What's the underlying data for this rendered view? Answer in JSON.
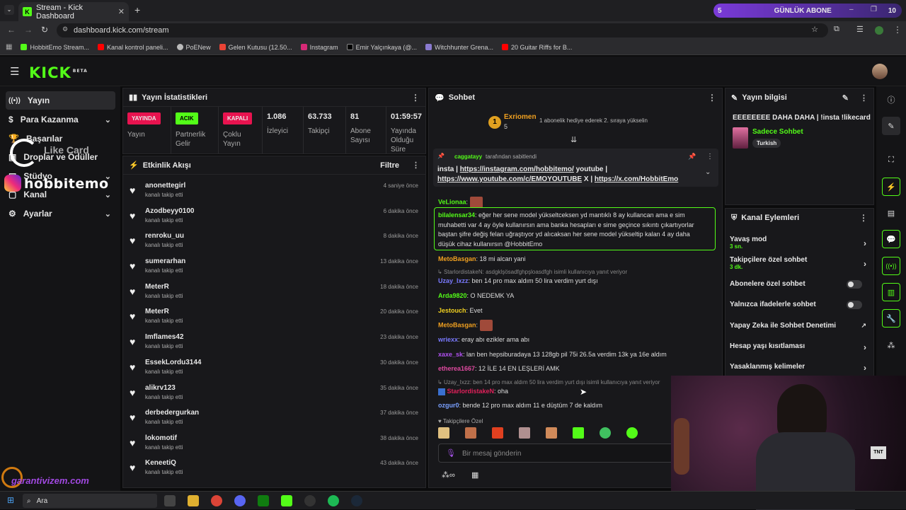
{
  "browser": {
    "tab_title": "Stream - Kick Dashboard",
    "url": "dashboard.kick.com/stream",
    "bookmarks": [
      "HobbitEmo Stream...",
      "Kanal kontrol paneli...",
      "PoENew",
      "Gelen Kutusu (12.50...",
      "Instagram",
      "Emir Yalçınkaya (@...",
      "Witchhunter Grena...",
      "20 Guitar Riffs for B..."
    ],
    "promo_count": "5",
    "promo_label": "GÜNLÜK ABONE",
    "promo_value": "10"
  },
  "header": {
    "logo": "KICK",
    "logo_badge": "BETA"
  },
  "sidebar": {
    "items": [
      {
        "label": "Yayın"
      },
      {
        "label": "Para Kazanma"
      },
      {
        "label": "Başarılar"
      },
      {
        "label": "Droplar ve Ödüller"
      },
      {
        "label": "Stüdyo"
      },
      {
        "label": "Kanal"
      },
      {
        "label": "Ayarlar"
      }
    ],
    "overlay_brand": "hobbitemo",
    "overlay_likecard": "Like Card"
  },
  "stats": {
    "title": "Yayın İstatistikleri",
    "cells": [
      {
        "badge": "YAYINDA",
        "label": "Yayın"
      },
      {
        "badge": "ACIK",
        "label": "Partnerlik Gelir"
      },
      {
        "badge": "KAPALI",
        "label": "Çoklu Yayın"
      },
      {
        "value": "1.086",
        "label": "İzleyici"
      },
      {
        "value": "63.733",
        "label": "Takipçi"
      },
      {
        "value": "81",
        "label": "Abone Sayısı"
      },
      {
        "value": "01:59:57",
        "label": "Yayında Olduğu Süre"
      }
    ],
    "colors": {
      "live": "#e8134f",
      "open": "#53fc18",
      "closed": "#e8134f"
    }
  },
  "activity": {
    "title": "Etkinlik Akışı",
    "filter": "Filtre",
    "events": [
      {
        "name": "anonettegirl",
        "sub": "kanalı takip etti",
        "time": "4 saniye önce"
      },
      {
        "name": "Azodbeyy0100",
        "sub": "kanalı takip etti",
        "time": "6 dakika önce"
      },
      {
        "name": "renroku_uu",
        "sub": "kanalı takip etti",
        "time": "8 dakika önce"
      },
      {
        "name": "sumerarhan",
        "sub": "kanalı takip etti",
        "time": "13 dakika önce"
      },
      {
        "name": "MeterR",
        "sub": "kanalı takip etti",
        "time": "18 dakika önce"
      },
      {
        "name": "MeterR",
        "sub": "kanalı takip etti",
        "time": "20 dakika önce"
      },
      {
        "name": "Imflames42",
        "sub": "kanalı takip etti",
        "time": "23 dakika önce"
      },
      {
        "name": "EssekLordu3144",
        "sub": "kanalı takip etti",
        "time": "30 dakika önce"
      },
      {
        "name": "alikrv123",
        "sub": "kanalı takip etti",
        "time": "35 dakika önce"
      },
      {
        "name": "derbedergurkan",
        "sub": "kanalı takip etti",
        "time": "37 dakika önce"
      },
      {
        "name": "lokomotif",
        "sub": "kanalı takip etti",
        "time": "38 dakika önce"
      },
      {
        "name": "KeneetiQ",
        "sub": "kanalı takip etti",
        "time": "43 dakika önce"
      }
    ]
  },
  "chat": {
    "title": "Sohbet",
    "gift_user": "Exriomen",
    "gift_count": "5",
    "gift_rank": "1",
    "gift_text": "1 abonelik hediye ederek 2. sıraya yükselin",
    "pinned_by_user": "caggatayy",
    "pinned_by_text": "tarafından sabitlendi",
    "pinned_line1_a": "insta | ",
    "pinned_link1": "https://instagram.com/hobbitemo/",
    "pinned_line1_b": " youtube |",
    "pinned_link2": "https://www.youtube.com/c/EMOYOUTUBE",
    "pinned_line2_b": " X | ",
    "pinned_link3": "https://x.com/HobbitEmo",
    "messages": [
      {
        "user": "VeLionaa",
        "text": ""
      },
      {
        "user": "bilalensar34",
        "text": ": eğer her sene model yükseltceksen yd mantıklı 8 ay kullancan ama e sim"
      },
      {
        "user": "",
        "text": "muhabetti var 4 ay öyle kullanırsın ama banka hesapları e sime geçince sıkıntı çıkartıyorlar"
      },
      {
        "user": "",
        "text": "baştan şifre değiş felan uğraştıyor yd alıcaksan her sene model yükseltip kalan 4 ay daha"
      },
      {
        "user": "",
        "text": "düşük cihaz kullanırsın @HobbitEmo"
      },
      {
        "user": "MetoBasgan",
        "text": ": 18 mi alcan yani"
      },
      {
        "user": "StarlordistakeN",
        "text": ": asdgklşösadfghpşloasdfgh isimli kullanıcıya yanıt veriyor"
      },
      {
        "user": "Uzay_Ixzz",
        "text": ": ben 14 pro max aldım 50 lira verdim yurt dışı"
      },
      {
        "user": "Arda9820",
        "text": ": O NEDEMK YA"
      },
      {
        "user": "Jestouch",
        "text": ": Evet"
      },
      {
        "user": "MetoBasgan",
        "text": ""
      },
      {
        "user": "wriexx",
        "text": ": eray abı ezikler ama abı"
      },
      {
        "user": "xaxe_sk",
        "text": ": lan ben hepsiburadaya 13 128gb pil 75i 26.5a verdim 13k ya 16e aldım"
      },
      {
        "user": "etherea1667",
        "text": ": 12 İLE 14 EN LEŞLERİ AMK"
      },
      {
        "user": "Uzay_Ixzz",
        "text": ": ben 14 pro max aldım 50 lira verdim yurt dışı isimli kullanıcıya yanıt veriyor"
      },
      {
        "user": "StarlordistakeN",
        "text": ": oha"
      },
      {
        "user": "ozgur0",
        "text": ": bende 12 pro max aldım 11 e düştüm 7 de kaldım"
      }
    ],
    "followers_label": "Takipçilere Özel",
    "input_placeholder": "Bir mesaj gönderin"
  },
  "stream_info": {
    "title": "Yayın bilgisi",
    "stream_title": "EEEEEEEE DAHA DAHA | !insta !likecard",
    "category": "Sadece Sohbet",
    "tag": "Turkish"
  },
  "channel_actions": {
    "title": "Kanal Eylemleri",
    "items": [
      {
        "label": "Yavaş mod",
        "sub": "3 sn.",
        "control": "arrow"
      },
      {
        "label": "Takipçilere özel sohbet",
        "sub": "3 dk.",
        "control": "arrow"
      },
      {
        "label": "Abonelere özel sohbet",
        "sub": "",
        "control": "toggle"
      },
      {
        "label": "Yalnızca ifadelerle sohbet",
        "sub": "",
        "control": "toggle"
      },
      {
        "label": "Yapay Zeka ile Sohbet Denetimi",
        "sub": "",
        "control": "external"
      },
      {
        "label": "Hesap yaşı kısıtlaması",
        "sub": "",
        "control": "arrow"
      },
      {
        "label": "Yasaklanmış kelimeler",
        "sub": "",
        "control": "arrow"
      }
    ]
  },
  "overlay": {
    "garanti": "garantivizem.com"
  },
  "taskbar": {
    "search": "Ara"
  },
  "colors": {
    "accent": "#53fc18",
    "bg": "#0b0b0c",
    "panel": "#18181b"
  }
}
